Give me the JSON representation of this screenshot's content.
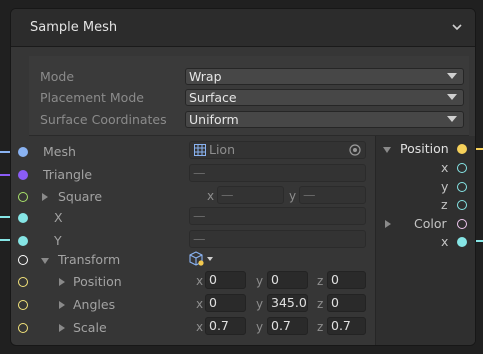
{
  "node": {
    "title": "Sample Mesh"
  },
  "settings": [
    {
      "label": "Mode",
      "value": "Wrap"
    },
    {
      "label": "Placement Mode",
      "value": "Surface"
    },
    {
      "label": "Surface Coordinates",
      "value": "Uniform"
    }
  ],
  "inputs": {
    "mesh": {
      "label": "Mesh",
      "value": "Lion",
      "color": "#8ab3f2"
    },
    "triangle": {
      "label": "Triangle",
      "value": "—",
      "color": "#8b5cf6"
    },
    "square": {
      "label": "Square",
      "x": "—",
      "y": "—",
      "color": "#a8e26a"
    },
    "x": {
      "label": "X",
      "value": "—",
      "color": "#86e6e6"
    },
    "y": {
      "label": "Y",
      "value": "—",
      "color": "#86e6e6"
    },
    "transform": {
      "label": "Transform",
      "color": "#ffffff"
    },
    "position": {
      "label": "Position",
      "x": "0",
      "y": "0",
      "z": "0",
      "color": "#f3e37a"
    },
    "angles": {
      "label": "Angles",
      "x": "0",
      "y": "345.0",
      "z": "0",
      "color": "#f3e37a"
    },
    "scale": {
      "label": "Scale",
      "x": "0.7",
      "y": "0.7",
      "z": "0.7",
      "color": "#f3e37a"
    }
  },
  "axis_labels": {
    "x": "x",
    "y": "y",
    "z": "z"
  },
  "outputs": {
    "position": {
      "label": "Position",
      "color": "#f6d15a"
    },
    "x": {
      "label": "x",
      "color": "#86e6e6"
    },
    "y": {
      "label": "y",
      "color": "#86e6e6"
    },
    "z": {
      "label": "z",
      "color": "#86e6e6"
    },
    "color": {
      "label": "Color",
      "color": "#f0c8f0"
    },
    "color_x": {
      "label": "x",
      "color": "#86e6e6"
    }
  },
  "icons": {
    "collapse": "chevron-down-icon",
    "mesh": "mesh-grid-icon",
    "object_picker": "object-picker-icon",
    "transform_space": "transform-space-icon"
  }
}
